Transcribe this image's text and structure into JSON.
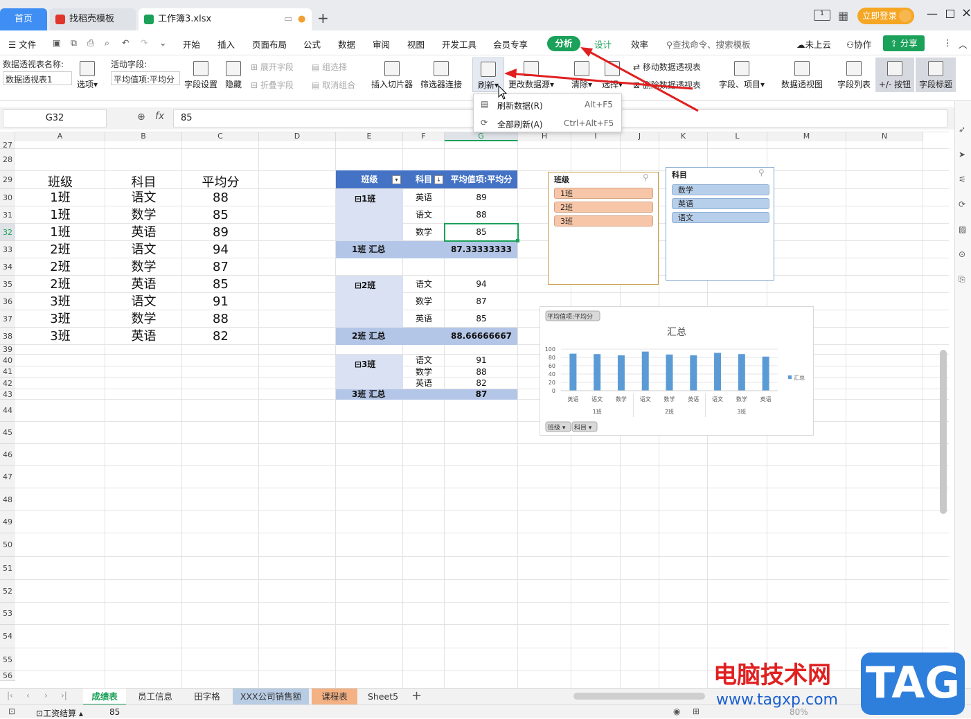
{
  "tabs": {
    "home": "首页",
    "templates": "找稻壳模板",
    "workbook": "工作簿3.xlsx",
    "add": "+"
  },
  "window": {
    "login": "立即登录"
  },
  "menu": {
    "file": "文件",
    "items": [
      "开始",
      "插入",
      "页面布局",
      "公式",
      "数据",
      "审阅",
      "视图",
      "开发工具",
      "会员专享"
    ],
    "analyze": "分析",
    "design": "设计",
    "efficiency": "效率",
    "search": "查找命令、搜索模板",
    "cloud": "未上云",
    "collab": "协作",
    "share": "分享"
  },
  "ribbon": {
    "pt_name_label": "数据透视表名称:",
    "pt_name_value": "数据透视表1",
    "options": "选项",
    "active_field_label": "活动字段:",
    "active_field_value": "平均值项:平均分",
    "field_settings": "字段设置",
    "hide": "隐藏",
    "expand_field": "展开字段",
    "collapse_field": "折叠字段",
    "group_sel": "组选择",
    "ungroup": "取消组合",
    "insert_slicer": "插入切片器",
    "filter_conn": "筛选器连接",
    "refresh": "刷新",
    "change_source": "更改数据源",
    "clear": "清除",
    "select": "选择",
    "move_pt": "移动数据透视表",
    "delete_pt": "删除数据透视表",
    "fields_items": "字段、项目",
    "pivot_chart": "数据透视图",
    "field_list": "字段列表",
    "plus_minus": "+/- 按钮",
    "field_headers": "字段标题"
  },
  "dropdown": {
    "items": [
      {
        "label": "刷新数据(R)",
        "shortcut": "Alt+F5"
      },
      {
        "label": "全部刷新(A)",
        "shortcut": "Ctrl+Alt+F5"
      }
    ]
  },
  "formula": {
    "cell_ref": "G32",
    "fx": "fx",
    "value": "85"
  },
  "columns": [
    "A",
    "B",
    "C",
    "D",
    "E",
    "F",
    "G",
    "H",
    "I",
    "J",
    "K",
    "L",
    "M",
    "N"
  ],
  "rows": [
    "27",
    "28",
    "29",
    "30",
    "31",
    "32",
    "33",
    "34",
    "35",
    "36",
    "37",
    "38",
    "39",
    "40",
    "41",
    "42",
    "43",
    "44",
    "45",
    "46",
    "47",
    "48",
    "49",
    "50",
    "51",
    "52",
    "53",
    "54",
    "55",
    "56"
  ],
  "table": {
    "headers": [
      "班级",
      "科目",
      "平均分"
    ],
    "rows": [
      [
        "1班",
        "语文",
        "88"
      ],
      [
        "1班",
        "数学",
        "85"
      ],
      [
        "1班",
        "英语",
        "89"
      ],
      [
        "2班",
        "语文",
        "94"
      ],
      [
        "2班",
        "数学",
        "87"
      ],
      [
        "2班",
        "英语",
        "85"
      ],
      [
        "3班",
        "语文",
        "91"
      ],
      [
        "3班",
        "数学",
        "88"
      ],
      [
        "3班",
        "英语",
        "82"
      ]
    ]
  },
  "pivot": {
    "headers": [
      "班级",
      "科目",
      "平均值项:平均分"
    ],
    "groups": [
      {
        "label": "⊟1班",
        "items": [
          [
            "英语",
            "89"
          ],
          [
            "语文",
            "88"
          ],
          [
            "数学",
            "85"
          ]
        ],
        "total_label": "1班 汇总",
        "total": "87.33333333"
      },
      {
        "label": "⊟2班",
        "items": [
          [
            "语文",
            "94"
          ],
          [
            "数学",
            "87"
          ],
          [
            "英语",
            "85"
          ]
        ],
        "total_label": "2班 汇总",
        "total": "88.66666667"
      },
      {
        "label": "⊟3班",
        "items": [
          [
            "语文",
            "91"
          ],
          [
            "数学",
            "88"
          ],
          [
            "英语",
            "82"
          ]
        ],
        "total_label": "3班 汇总",
        "total": "87"
      }
    ]
  },
  "slicer_class": {
    "title": "班级",
    "items": [
      "1班",
      "2班",
      "3班"
    ]
  },
  "slicer_subject": {
    "title": "科目",
    "items": [
      "数学",
      "英语",
      "语文"
    ]
  },
  "chart_data": {
    "type": "bar",
    "title": "汇总",
    "field_button": "平均值项:平均分",
    "categories": [
      "英语",
      "语文",
      "数学",
      "语文",
      "数学",
      "英语",
      "语文",
      "数学",
      "英语"
    ],
    "groups": [
      "1班",
      "2班",
      "3班"
    ],
    "series": [
      {
        "name": "汇总",
        "values": [
          89,
          88,
          85,
          94,
          87,
          85,
          91,
          88,
          82
        ]
      }
    ],
    "ylim": [
      0,
      100
    ],
    "yticks": [
      "100",
      "80",
      "60",
      "40",
      "20",
      "0"
    ],
    "legend": "right",
    "filters": [
      "班级",
      "科目"
    ],
    "color": "#5b9bd5"
  },
  "sheets": [
    "成绩表",
    "员工信息",
    "田字格",
    "XXX公司销售额",
    "课程表",
    "Sheet5"
  ],
  "status": {
    "mode": "工资结算",
    "value": "85",
    "zoom": "80%"
  },
  "watermark": {
    "brand": "电脑技术网",
    "url": "www.tagxp.com",
    "logo": "TAG"
  }
}
